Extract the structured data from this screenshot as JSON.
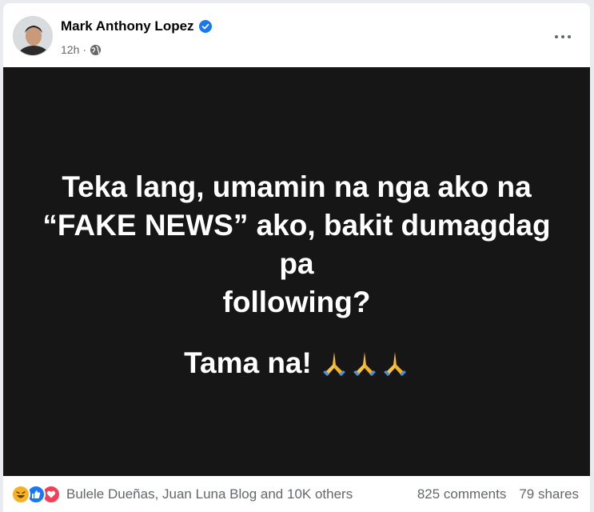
{
  "post": {
    "author": "Mark Anthony Lopez",
    "time": "12h",
    "separator": "·",
    "text_lines": "Teka lang, umamin na nga ako na\n“FAKE NEWS” ako, bakit dumagdag\npa\nfollowing?",
    "text_line2": "Tama na!",
    "background_color": "#161616"
  },
  "footer": {
    "reactors": "Bulele Dueñas, Juan Luna Blog and 10K others",
    "comments": "825 comments",
    "shares": "79 shares"
  },
  "colors": {
    "verified": "#1877f2",
    "like": "#1877f2",
    "love": "#f33e58",
    "haha": "#f7b125"
  }
}
